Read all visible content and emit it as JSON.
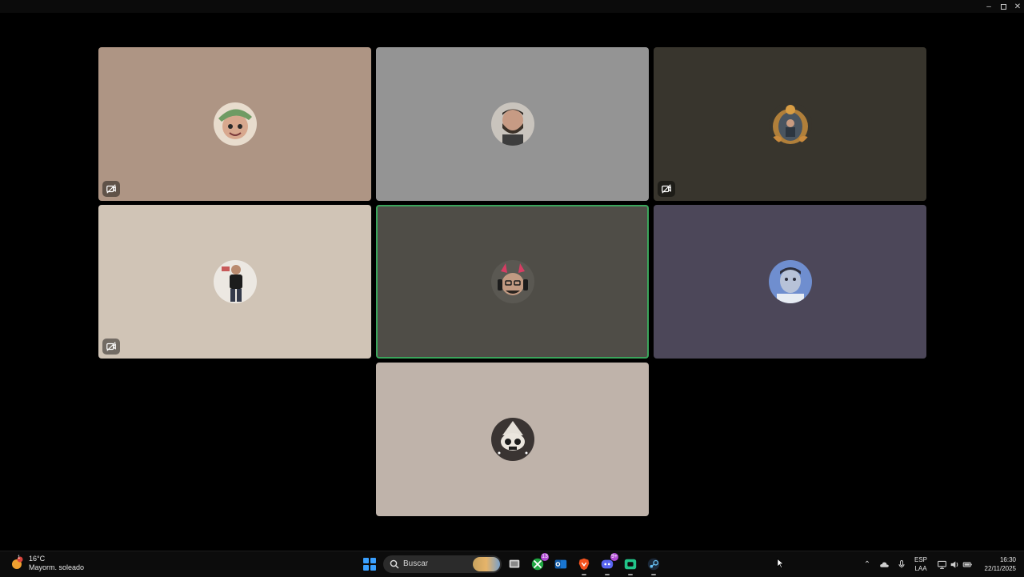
{
  "window": {
    "controls": [
      "minimize",
      "maximize",
      "close"
    ]
  },
  "participants": [
    {
      "avatar": "avatar-green-cap",
      "tile_color": "#ae9584",
      "camera_off": true,
      "speaking": false
    },
    {
      "avatar": "avatar-bearded-man",
      "tile_color": "#949494",
      "camera_off": false,
      "speaking": false
    },
    {
      "avatar": "avatar-mirror-selfie-frame",
      "tile_color": "#38352d",
      "camera_off": true,
      "speaking": false
    },
    {
      "avatar": "avatar-standing-person",
      "tile_color": "#d0c4b6",
      "camera_off": true,
      "speaking": false
    },
    {
      "avatar": "avatar-headphones-horns",
      "tile_color": "#4f4d47",
      "camera_off": false,
      "speaking": true
    },
    {
      "avatar": "avatar-blue-face",
      "tile_color": "#4c4759",
      "camera_off": false,
      "speaking": false
    },
    {
      "avatar": "avatar-skull-hat",
      "tile_color": "#bfb3aa",
      "camera_off": false,
      "speaking": false
    }
  ],
  "colors": {
    "speaking_border": "#3ba55c",
    "background": "#000000",
    "taskbar": "#0c0c0c"
  },
  "taskbar": {
    "weather": {
      "temp": "16°C",
      "condition": "Mayorm. soleado",
      "alert_count": "1"
    },
    "search": {
      "placeholder": "Buscar"
    },
    "apps": [
      {
        "name": "task-view-icon"
      },
      {
        "name": "xbox-icon",
        "badge": "13"
      },
      {
        "name": "outlook-icon"
      },
      {
        "name": "brave-browser-icon"
      },
      {
        "name": "discord-icon",
        "badge": "9+"
      },
      {
        "name": "green-chat-app-icon"
      },
      {
        "name": "steam-icon"
      }
    ],
    "tray": {
      "language_top": "ESP",
      "language_bottom": "LAA",
      "time": "16:30",
      "date": "22/11/2025"
    }
  }
}
